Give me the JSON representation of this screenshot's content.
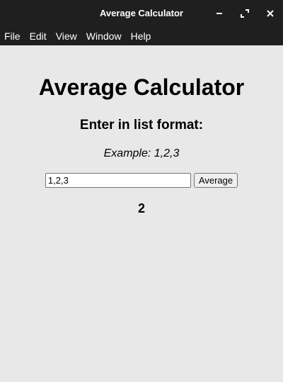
{
  "window": {
    "title": "Average Calculator"
  },
  "menubar": {
    "items": [
      {
        "label": "File"
      },
      {
        "label": "Edit"
      },
      {
        "label": "View"
      },
      {
        "label": "Window"
      },
      {
        "label": "Help"
      }
    ]
  },
  "main": {
    "heading": "Average Calculator",
    "subheading": "Enter in list format:",
    "example": "Example: 1,2,3",
    "input_value": "1,2,3",
    "button_label": "Average",
    "result": "2"
  },
  "icons": {
    "minimize": "minimize-icon",
    "maximize": "maximize-icon",
    "close": "close-icon"
  },
  "colors": {
    "titlebar": "#1f1f1f",
    "background": "#e8e8e8"
  }
}
